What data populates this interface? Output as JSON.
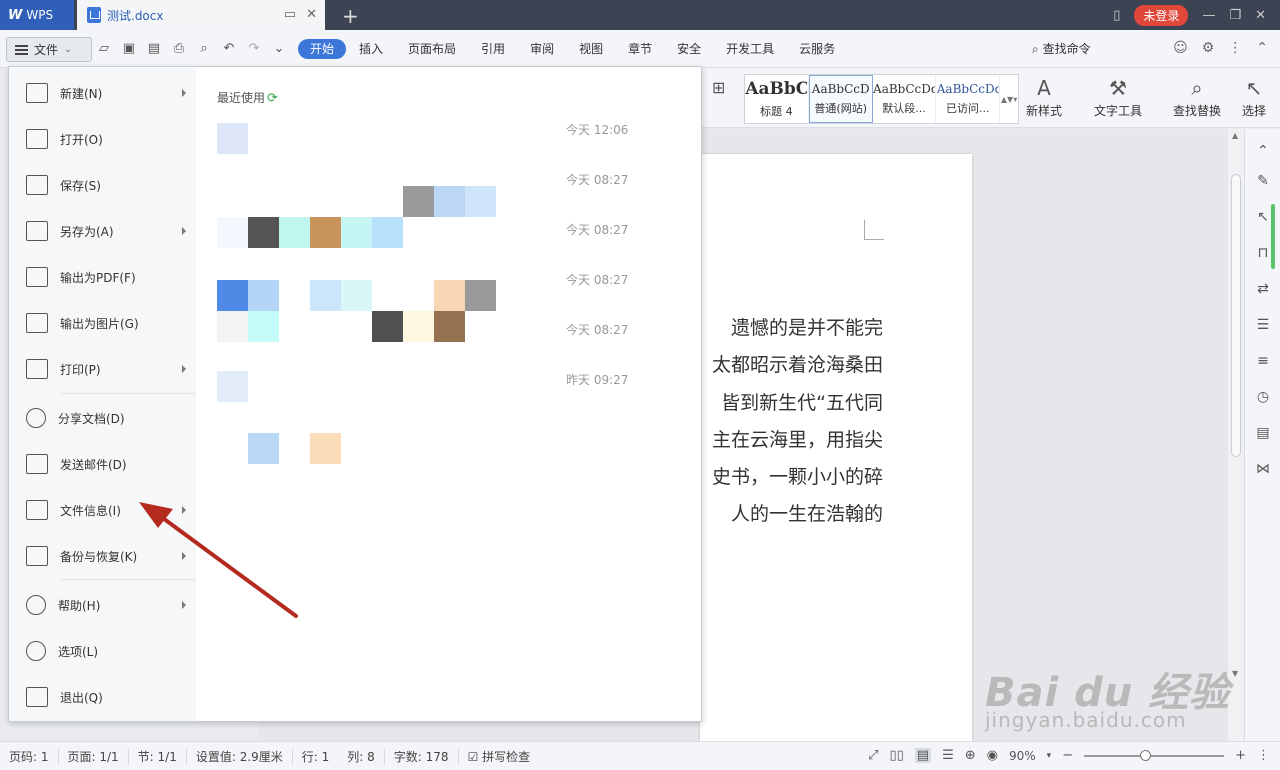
{
  "titlebar": {
    "app_tab": "WPS",
    "doc_tab": "测试.docx",
    "login": "未登录"
  },
  "menubar": {
    "file_label": "文件",
    "tabs": [
      "开始",
      "插入",
      "页面布局",
      "引用",
      "审阅",
      "视图",
      "章节",
      "安全",
      "开发工具",
      "云服务"
    ],
    "active_tab": "开始",
    "search_cmd": "查找命令"
  },
  "ribbon": {
    "styles": [
      {
        "sample": "AaBbC",
        "name": "标题 4"
      },
      {
        "sample": "AaBbCcD",
        "name": "普通(网站)"
      },
      {
        "sample": "AaBbCcDd",
        "name": "默认段..."
      },
      {
        "sample": "AaBbCcDd",
        "name": "已访问..."
      }
    ],
    "new_style": "新样式",
    "text_tools": "文字工具",
    "find_replace": "查找替换",
    "select": "选择"
  },
  "file_menu": {
    "items": [
      {
        "label": "新建(N)",
        "icon": "new-document-icon",
        "submenu": true
      },
      {
        "label": "打开(O)",
        "icon": "folder-open-icon",
        "submenu": false
      },
      {
        "label": "保存(S)",
        "icon": "save-icon",
        "submenu": false
      },
      {
        "label": "另存为(A)",
        "icon": "save-as-icon",
        "submenu": true
      },
      {
        "label": "输出为PDF(F)",
        "icon": "pdf-icon",
        "submenu": false
      },
      {
        "label": "输出为图片(G)",
        "icon": "image-icon",
        "submenu": false
      },
      {
        "label": "打印(P)",
        "icon": "printer-icon",
        "submenu": true
      },
      {
        "label": "分享文档(D)",
        "icon": "share-icon",
        "submenu": false
      },
      {
        "label": "发送邮件(D)",
        "icon": "mail-icon",
        "submenu": false
      },
      {
        "label": "文件信息(I)",
        "icon": "file-info-icon",
        "submenu": true
      },
      {
        "label": "备份与恢复(K)",
        "icon": "backup-icon",
        "submenu": true
      },
      {
        "label": "帮助(H)",
        "icon": "help-icon",
        "submenu": true
      },
      {
        "label": "选项(L)",
        "icon": "gear-icon",
        "submenu": false
      },
      {
        "label": "退出(Q)",
        "icon": "exit-icon",
        "submenu": false
      }
    ],
    "recent_title": "最近使用",
    "recent_times": [
      "今天 12:06",
      "今天 08:27",
      "今天 08:27",
      "今天 08:27",
      "今天 08:27",
      "昨天 09:27"
    ]
  },
  "document": {
    "lines": [
      "遗憾的是并不能完",
      "太都昭示着沧海桑田",
      "皆到新生代“五代同",
      "主在云海里，用指尖",
      "史书，一颗小小的碎",
      "人的一生在浩翰的"
    ]
  },
  "statusbar": {
    "page_code": "页码: 1",
    "page": "页面: 1/1",
    "section": "节: 1/1",
    "setting": "设置值: 2.9厘米",
    "row": "行: 1",
    "col": "列: 8",
    "word_count": "字数: 178",
    "spell_check": "拼写检查",
    "zoom": "90%"
  },
  "watermark": {
    "brand": "Bai du 经验",
    "url": "jingyan.baidu.com"
  }
}
